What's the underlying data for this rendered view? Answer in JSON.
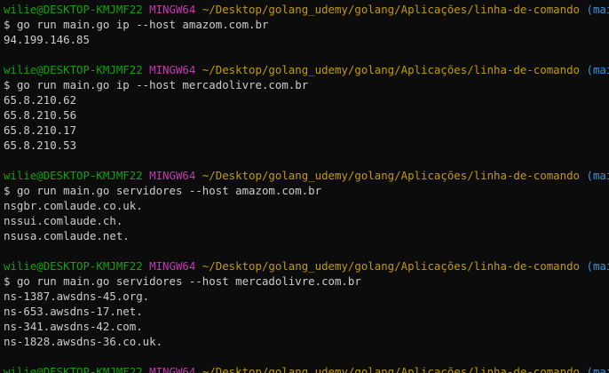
{
  "terminal": {
    "prompt": {
      "user_host": "wilie@DESKTOP-KMJMF22",
      "system": "MINGW64",
      "path": "~/Desktop/golang_udemy/golang/Aplicações/linha-de-comando",
      "branch": "(main)",
      "symbol": "$"
    },
    "blocks": [
      {
        "command": "go run main.go ip --host amazom.com.br",
        "output": [
          "94.199.146.85"
        ]
      },
      {
        "command": "go run main.go ip --host mercadolivre.com.br",
        "output": [
          "65.8.210.62",
          "65.8.210.56",
          "65.8.210.17",
          "65.8.210.53"
        ]
      },
      {
        "command": "go run main.go servidores --host amazom.com.br",
        "output": [
          "nsgbr.comlaude.co.uk.",
          "nssui.comlaude.ch.",
          "nsusa.comlaude.net."
        ]
      },
      {
        "command": "go run main.go servidores --host mercadolivre.com.br",
        "output": [
          "ns-1387.awsdns-45.org.",
          "ns-653.awsdns-17.net.",
          "ns-341.awsdns-42.com.",
          "ns-1828.awsdns-36.co.uk."
        ]
      }
    ]
  },
  "colors": {
    "background": "#0c0c0c",
    "user_host": "#13a10e",
    "system": "#c239b3",
    "path": "#c19c00",
    "branch": "#3a96dd",
    "text": "#cccccc"
  }
}
